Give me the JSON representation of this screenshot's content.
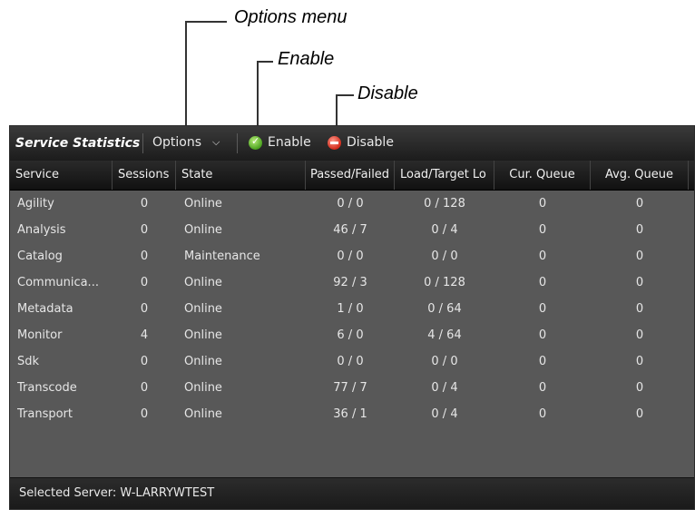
{
  "callouts": {
    "options_menu": "Options menu",
    "enable": "Enable",
    "disable": "Disable"
  },
  "toolbar": {
    "title": "Service Statistics",
    "options_label": "Options",
    "enable_label": "Enable",
    "disable_label": "Disable"
  },
  "columns": [
    "Service",
    "Sessions",
    "State",
    "Passed/Failed",
    "Load/Target Lo",
    "Cur. Queue",
    "Avg. Queue"
  ],
  "rows": [
    [
      "Agility",
      "0",
      "Online",
      "0 / 0",
      "0 / 128",
      "0",
      "0"
    ],
    [
      "Analysis",
      "0",
      "Online",
      "46 / 7",
      "0 / 4",
      "0",
      "0"
    ],
    [
      "Catalog",
      "0",
      "Maintenance",
      "0 / 0",
      "0 / 0",
      "0",
      "0"
    ],
    [
      "Communica...",
      "0",
      "Online",
      "92 / 3",
      "0 / 128",
      "0",
      "0"
    ],
    [
      "Metadata",
      "0",
      "Online",
      "1 / 0",
      "0 / 64",
      "0",
      "0"
    ],
    [
      "Monitor",
      "4",
      "Online",
      "6 / 0",
      "4 / 64",
      "0",
      "0"
    ],
    [
      "Sdk",
      "0",
      "Online",
      "0 / 0",
      "0 / 0",
      "0",
      "0"
    ],
    [
      "Transcode",
      "0",
      "Online",
      "77 / 7",
      "0 / 4",
      "0",
      "0"
    ],
    [
      "Transport",
      "0",
      "Online",
      "36 / 1",
      "0 / 4",
      "0",
      "0"
    ]
  ],
  "status_bar": {
    "text": "Selected Server: W-LARRYWTEST"
  }
}
